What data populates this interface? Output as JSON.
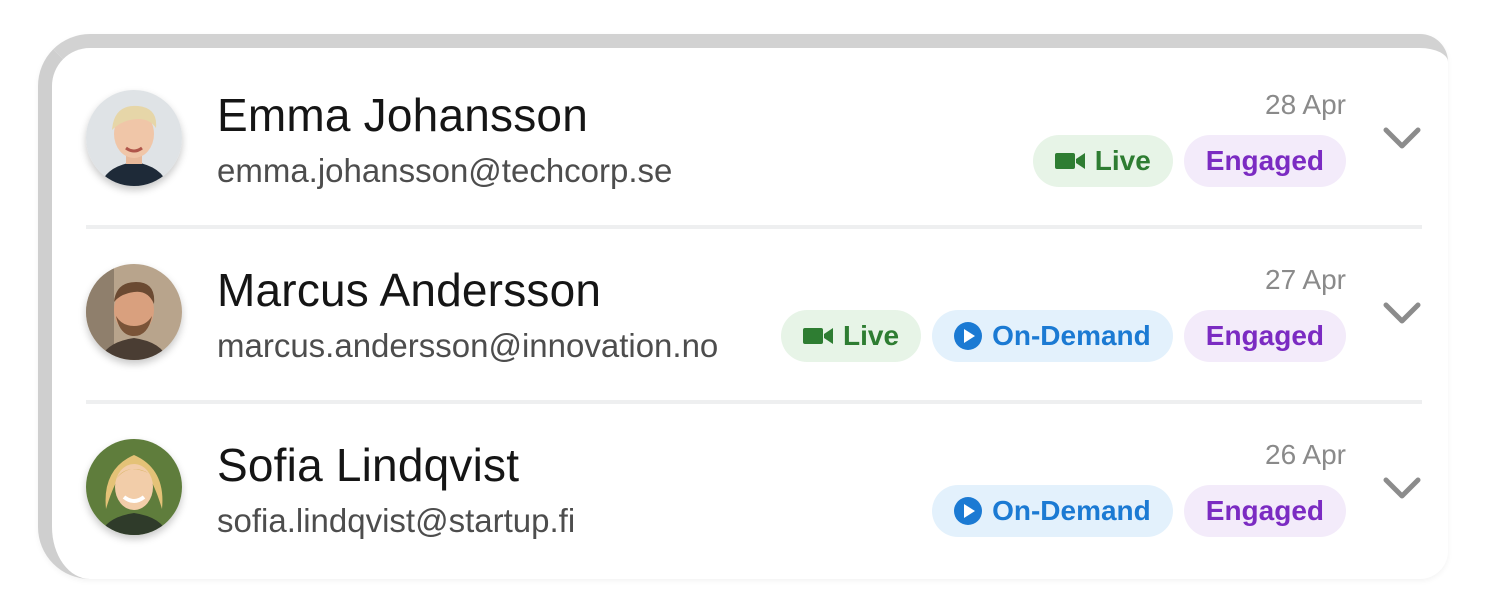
{
  "attendees": [
    {
      "name": "Emma Johansson",
      "email": "emma.johansson@techcorp.se",
      "date": "28 Apr",
      "badges": {
        "live": "Live",
        "engaged": "Engaged"
      }
    },
    {
      "name": "Marcus Andersson",
      "email": "marcus.andersson@innovation.no",
      "date": "27 Apr",
      "badges": {
        "live": "Live",
        "on_demand": "On-Demand",
        "engaged": "Engaged"
      }
    },
    {
      "name": "Sofia Lindqvist",
      "email": "sofia.lindqvist@startup.fi",
      "date": "26 Apr",
      "badges": {
        "on_demand": "On-Demand",
        "engaged": "Engaged"
      }
    }
  ],
  "colors": {
    "live_bg": "#e7f4e7",
    "live_fg": "#2e7d32",
    "on_demand_bg": "#e3f1fc",
    "on_demand_fg": "#1b7ad3",
    "engaged_bg": "#f3ebfa",
    "engaged_fg": "#7b2bc2"
  },
  "icons": {
    "live": "video-camera-icon",
    "on_demand": "play-circle-icon",
    "expand": "chevron-down-icon"
  }
}
